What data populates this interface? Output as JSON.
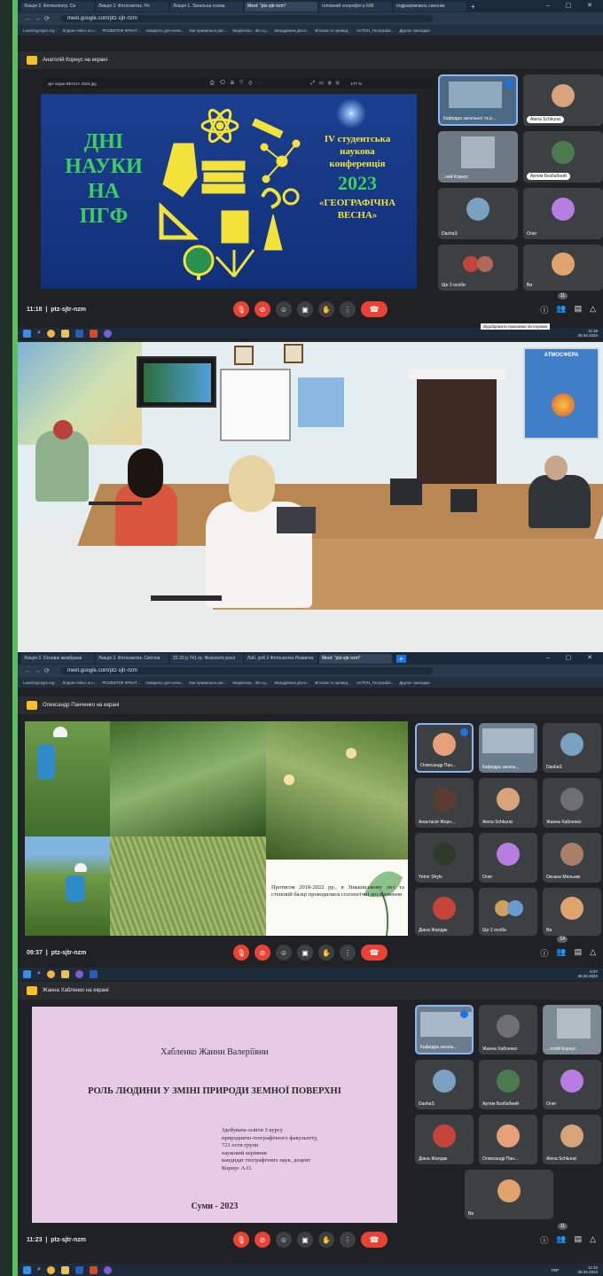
{
  "panel1": {
    "tabs": [
      "Лекція 2. Фотоелектр. Св",
      "Лекція 3. Фотосинтез. Нч",
      "Лекція 1. Загальна схема",
      "Meet: \"ptz-sjtr-nzm\"",
      "головний хлорофіл р 690",
      "подразумевать синонім"
    ],
    "url": "meet.google.com/ptz-sjtr-nzm",
    "bookmarks": [
      "LearningApps.org -",
      "Лоррен Месс ж н...",
      "РОЗВИТОК КРЕАТ...",
      "Акварель для начи...",
      "Как правильно рис...",
      "Медіатека - 3D-сц...",
      "Мандрівник Досл...",
      "Вітаємо із провед...",
      "АСТОН_Географів...",
      "Другие закладки"
    ],
    "presenter": "Анатолій Корнус на екрані",
    "doc_name": "Дні науки ВЕСНА 2023.jpg",
    "zoom": "177 %",
    "slide_left": [
      "ДНІ",
      "НАУКИ",
      "НА",
      "ПГФ"
    ],
    "slide_right": [
      "IV студентська",
      "наукова",
      "конференція",
      "2023",
      "«ГЕОГРАФІЧНА",
      "ВЕСНА»"
    ],
    "tiles": [
      "Кафедра загальної та р...",
      "Alena Schkurat",
      "...ний Корнус",
      "Артем Безбабний",
      "DashaS",
      "Олег",
      "Ще 3 особи",
      "Ви"
    ],
    "time": "11:18",
    "code": "ptz-sjtr-nzm",
    "people_count": "11",
    "tooltip": "Відображати приховані піктограми",
    "clock_time": "11:18",
    "clock_date": "25.04.2023"
  },
  "panel2": {
    "poster": "АТМОСФЕРА"
  },
  "panel3": {
    "tabs": [
      "Лекція 2. Основні мембрани",
      "Лекція 2. Фотосинтез. Світлов",
      "22-23 р 741 гр. Фізіологія росл",
      "Лаб. роб 2 Фотосинтез Розвиток",
      "Meet: \"ptz-sjtr-nzm\""
    ],
    "url": "meet.google.com/ptz-sjtr-nzm",
    "bookmarks": [
      "LearningApps.org -",
      "Лоррен Месс ж н...",
      "РОЗВИТОК КРЕАТ...",
      "Акварель для начи...",
      "Как правильно рис...",
      "Медіатека - 3D-сц...",
      "Мандрівник Досл...",
      "Вітаємо із провед...",
      "АСТОН_Географів...",
      "Другие закладки"
    ],
    "presenter": "Олександр Панченко на екрані",
    "caption": "Протягом 2018-2022 рр., в Зіньківському лісі та степовій балці проводилися созологічні дослідження",
    "tiles": [
      "Олександр Пан...",
      "Кафедра загаль...",
      "DashaS",
      "Анастасія Жорн...",
      "Alena Schkurat",
      "Жанна Хабленко",
      "Yehor Shylo",
      "Олег",
      "Оксана Мельник",
      "Діана Жалдак",
      "Ще 2 особи",
      "Ви"
    ],
    "time": "09:37",
    "code": "ptz-sjtr-nzm",
    "people_count": "14",
    "clock_time": "9:37",
    "clock_date": "25.04.2023"
  },
  "panel4": {
    "presenter": "Жанна Хабленко на екрані",
    "author": "Хабленко Жанни Валеріївни",
    "title": "РОЛЬ ЛЮДИНИ У ЗМІНІ ПРИРОДИ ЗЕМНОЇ ПОВЕРХНІ",
    "details": [
      "Здобувача освіти 3 курсу",
      "природничо-географічного факультету,",
      "721 ести групи",
      "науковий керівник",
      "кандидат географічних наук, доцент",
      "Корнус А.О."
    ],
    "city": "Суми - 2023",
    "tiles": [
      "Кафедра загаль...",
      "Жанна Хабленко",
      "...толій Корнус",
      "DashaS",
      "Артем Безбабний",
      "Олег",
      "Діана Жалдак",
      "Олександр Пан...",
      "Alena Schkurat",
      "Ви"
    ],
    "time": "11:23",
    "code": "ptz-sjtr-nzm",
    "people_count": "11",
    "lang": "УКР",
    "clock_time": "11:23",
    "clock_date": "25.04.2023",
    "top_clock_time": "9:37",
    "top_clock_date": "25.04.2023"
  },
  "colors": {
    "meet_bg": "#202124",
    "hangup": "#ea4335",
    "accent": "#8ab4f8",
    "slide_gold": "#f2e23a",
    "slide_green": "#3ecf5a",
    "slide4_bg": "#e7cbe6"
  }
}
